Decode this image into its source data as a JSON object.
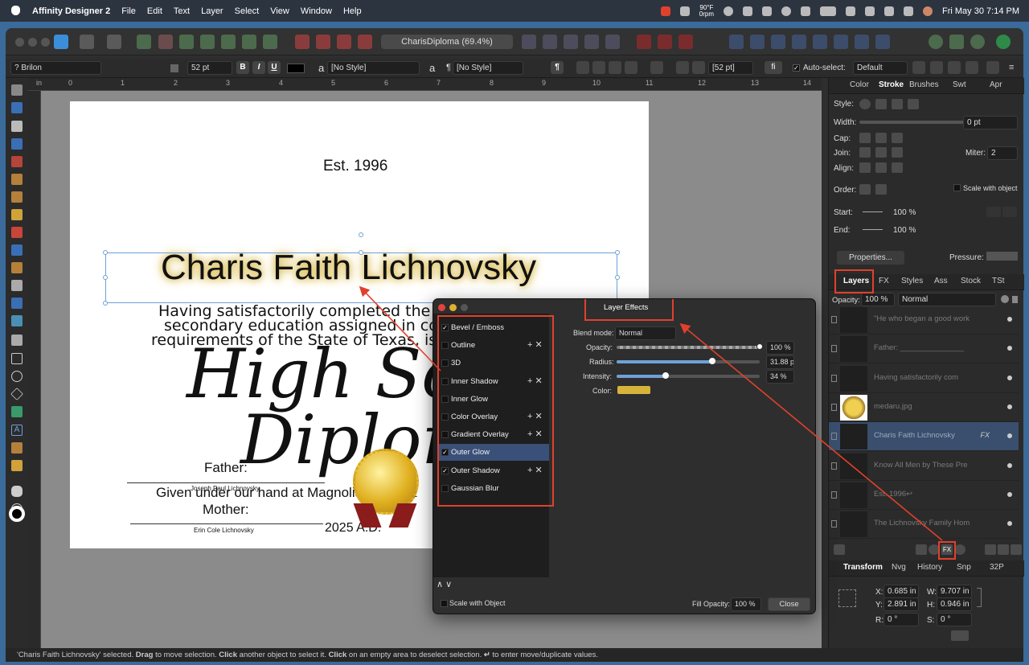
{
  "menubar": {
    "app": "Affinity Designer 2",
    "items": [
      "File",
      "Edit",
      "Text",
      "Layer",
      "Select",
      "View",
      "Window",
      "Help"
    ],
    "weather": "90°F",
    "weather2": "0rpm",
    "datetime": "Fri May 30  7:14 PM"
  },
  "window": {
    "doc_title": "CharisDiploma (69.4%)"
  },
  "context": {
    "font": "? Brilon",
    "size": "52 pt",
    "bold": "B",
    "italic": "I",
    "underline": "U",
    "char_style_icon": "a",
    "char_style": "[No Style]",
    "para_style_icon": "a",
    "para_style": "[No Style]",
    "para_mark": "¶",
    "leading": "[52 pt]",
    "fi": "fi",
    "autoselect": "Auto-select:",
    "autoselect_mode": "Default"
  },
  "ruler": {
    "unit": "in",
    "marks": [
      "0",
      "1",
      "2",
      "3",
      "4",
      "5",
      "6",
      "7",
      "8",
      "9",
      "10",
      "11",
      "12",
      "13",
      "14"
    ]
  },
  "page": {
    "est": "Est. 1996",
    "name": "Charis Faith Lichnovsky",
    "body1": "Having satisfactorily completed the pre",
    "body2": "secondary education assigned in conf",
    "body3": "requirements of the State of Texas, is h",
    "title1": "High Sch",
    "title2": "Diplom",
    "father_label": "Father:",
    "father_name": "Joseph Paul Lichnovsky",
    "given": "Given under our hand at Magnolia, Texas, t",
    "mother_label": "Mother:",
    "mother_name": "Erin Cole Lichnovsky",
    "year": "2025 A.D."
  },
  "stroke_panel": {
    "tabs": [
      "Color",
      "Stroke",
      "Brushes",
      "Swt",
      "Apr"
    ],
    "active": "Stroke",
    "style_label": "Style:",
    "width_label": "Width:",
    "width": "0 pt",
    "cap_label": "Cap:",
    "join_label": "Join:",
    "miter_label": "Miter:",
    "miter": "2",
    "align_label": "Align:",
    "order_label": "Order:",
    "scale_label": "Scale with object",
    "start_label": "Start:",
    "start_pct": "100 %",
    "end_label": "End:",
    "end_pct": "100 %",
    "properties": "Properties...",
    "pressure": "Pressure:"
  },
  "layers_panel": {
    "tabs": [
      "Layers",
      "FX",
      "Styles",
      "Ass",
      "Stock",
      "TSt"
    ],
    "active": "Layers",
    "opacity_label": "Opacity:",
    "opacity": "100 %",
    "blend": "Normal",
    "layers": [
      {
        "name": "\"He who began a good work"
      },
      {
        "name": "Father: _______________"
      },
      {
        "name": "Having satisfactorily com"
      },
      {
        "name": "medaru.jpg"
      },
      {
        "name": "Charis Faith Lichnovsky",
        "fx": "FX"
      },
      {
        "name": "Know All Men by These Pre"
      },
      {
        "name": "Est. 1996↩"
      },
      {
        "name": "The Lichnovsky Family Hom"
      }
    ],
    "fx_button": "FX"
  },
  "transform_panel": {
    "tabs": [
      "Transform",
      "Nvg",
      "History",
      "Snp",
      "32P"
    ],
    "active": "Transform",
    "x_label": "X:",
    "x": "0.685 in",
    "y_label": "Y:",
    "y": "2.891 in",
    "w_label": "W:",
    "w": "9.707 in",
    "h_label": "H:",
    "h": "0.946 in",
    "r_label": "R:",
    "r": "0 °",
    "s_label": "S:",
    "s": "0 °"
  },
  "effects": {
    "title": "Layer Effects",
    "items": [
      {
        "name": "Bevel / Emboss",
        "checked": true,
        "plus": false
      },
      {
        "name": "Outline",
        "checked": false,
        "plus": true
      },
      {
        "name": "3D",
        "checked": false,
        "plus": false
      },
      {
        "name": "Inner Shadow",
        "checked": false,
        "plus": true
      },
      {
        "name": "Inner Glow",
        "checked": false,
        "plus": false
      },
      {
        "name": "Color Overlay",
        "checked": false,
        "plus": true
      },
      {
        "name": "Gradient Overlay",
        "checked": false,
        "plus": true
      },
      {
        "name": "Outer Glow",
        "checked": true,
        "plus": false,
        "selected": true
      },
      {
        "name": "Outer Shadow",
        "checked": true,
        "plus": true
      },
      {
        "name": "Gaussian Blur",
        "checked": false,
        "plus": false
      }
    ],
    "plus_x": "+ ✕",
    "check": "✓",
    "updown": "∧ ∨",
    "blend_label": "Blend mode:",
    "blend": "Normal",
    "opacity_label": "Opacity:",
    "opacity": "100 %",
    "opacity_level": 1.0,
    "radius_label": "Radius:",
    "radius": "31.88 p",
    "radius_level": 0.67,
    "intensity_label": "Intensity:",
    "intensity": "34 %",
    "intensity_level": 0.34,
    "color_label": "Color:",
    "glow_color": "#d6b43c",
    "scale_label": "Scale with Object",
    "fill_label": "Fill Opacity:",
    "fill": "100 %",
    "close": "Close"
  },
  "status": {
    "t1": "'Charis Faith Lichnovsky' selected. ",
    "b1": "Drag",
    "t2": " to move selection. ",
    "b2": "Click",
    "t3": " another object to select it. ",
    "b3": "Click",
    "t4": " on an empty area to deselect selection. ",
    "b4": "↵",
    "t5": " to enter move/duplicate values."
  },
  "colors": {
    "accent": "#3a6fb5",
    "highlight": "#e0412c"
  }
}
